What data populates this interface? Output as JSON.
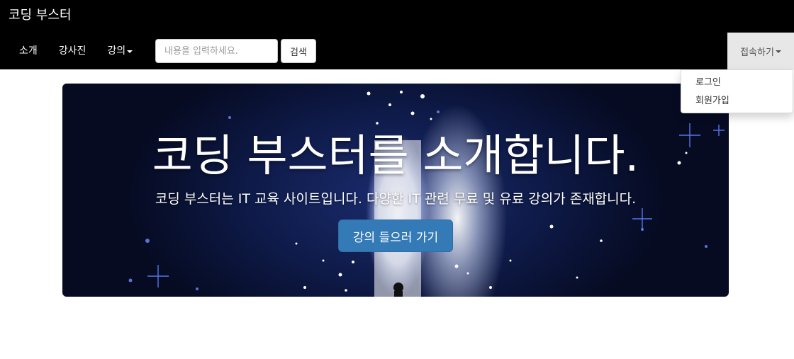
{
  "navbar": {
    "brand": "코딩 부스터",
    "links": [
      {
        "label": "소개"
      },
      {
        "label": "강사진"
      },
      {
        "label": "강의"
      }
    ],
    "search": {
      "placeholder": "내용을 입력하세요.",
      "value": "",
      "button_label": "검색"
    },
    "account_toggle": "접속하기"
  },
  "dropdown": {
    "items": [
      {
        "label": "로그인"
      },
      {
        "label": "회원가입"
      }
    ]
  },
  "jumbotron": {
    "title": "코딩 부스터를 소개합니다.",
    "lead": "코딩 부스터는 IT 교육 사이트입니다. 다양한 IT 관련 무료 및 유료 강의가 존재합니다.",
    "button_label": "강의 들으러 가기",
    "background_description_colors": {
      "sky": "#0e1a48",
      "glow": "#ffffff"
    }
  },
  "colors": {
    "navbar_bg": "#000000",
    "primary_button": "#337ab7",
    "active_toggle_bg": "#e7e7e7"
  }
}
